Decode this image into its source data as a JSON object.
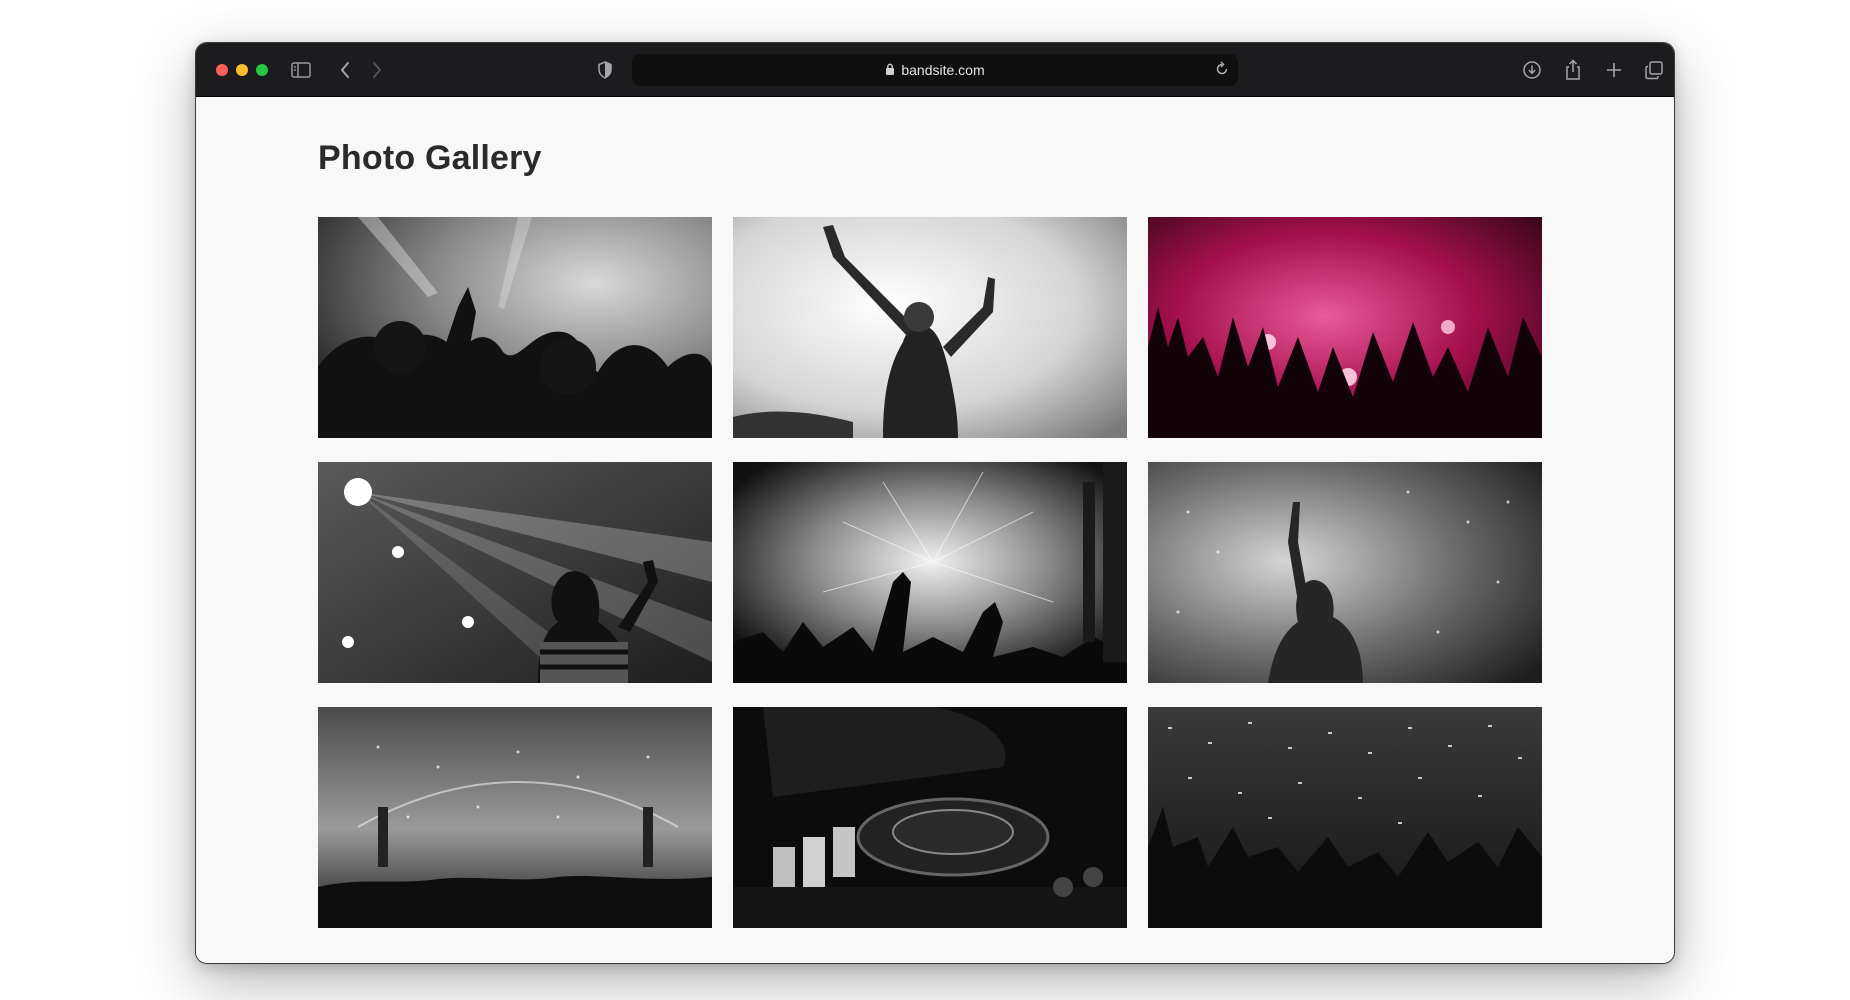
{
  "browser": {
    "url": "bandsite.com",
    "icons": {
      "sidebar": "sidebar-icon",
      "back": "chevron-left-icon",
      "forward": "chevron-right-icon",
      "privacy": "shield-icon",
      "lock": "lock-icon",
      "reload": "reload-icon",
      "download": "download-icon",
      "share": "share-icon",
      "new_tab": "plus-icon",
      "tabs": "tabs-overview-icon"
    }
  },
  "page": {
    "title": "Photo Gallery"
  },
  "gallery": {
    "columns": 3,
    "photos": [
      {
        "alt": "",
        "tone": "monochrome"
      },
      {
        "alt": "",
        "tone": "monochrome"
      },
      {
        "alt": "",
        "tone": "magenta"
      },
      {
        "alt": "",
        "tone": "monochrome"
      },
      {
        "alt": "",
        "tone": "monochrome"
      },
      {
        "alt": "",
        "tone": "monochrome"
      },
      {
        "alt": "",
        "tone": "monochrome"
      },
      {
        "alt": "",
        "tone": "monochrome"
      },
      {
        "alt": "",
        "tone": "monochrome"
      }
    ]
  },
  "colors": {
    "toolbar_bg": "#1c1c1e",
    "page_bg": "#f8f8f8",
    "title_color": "#2a2a2a",
    "accent_magenta": "#c2185b"
  }
}
